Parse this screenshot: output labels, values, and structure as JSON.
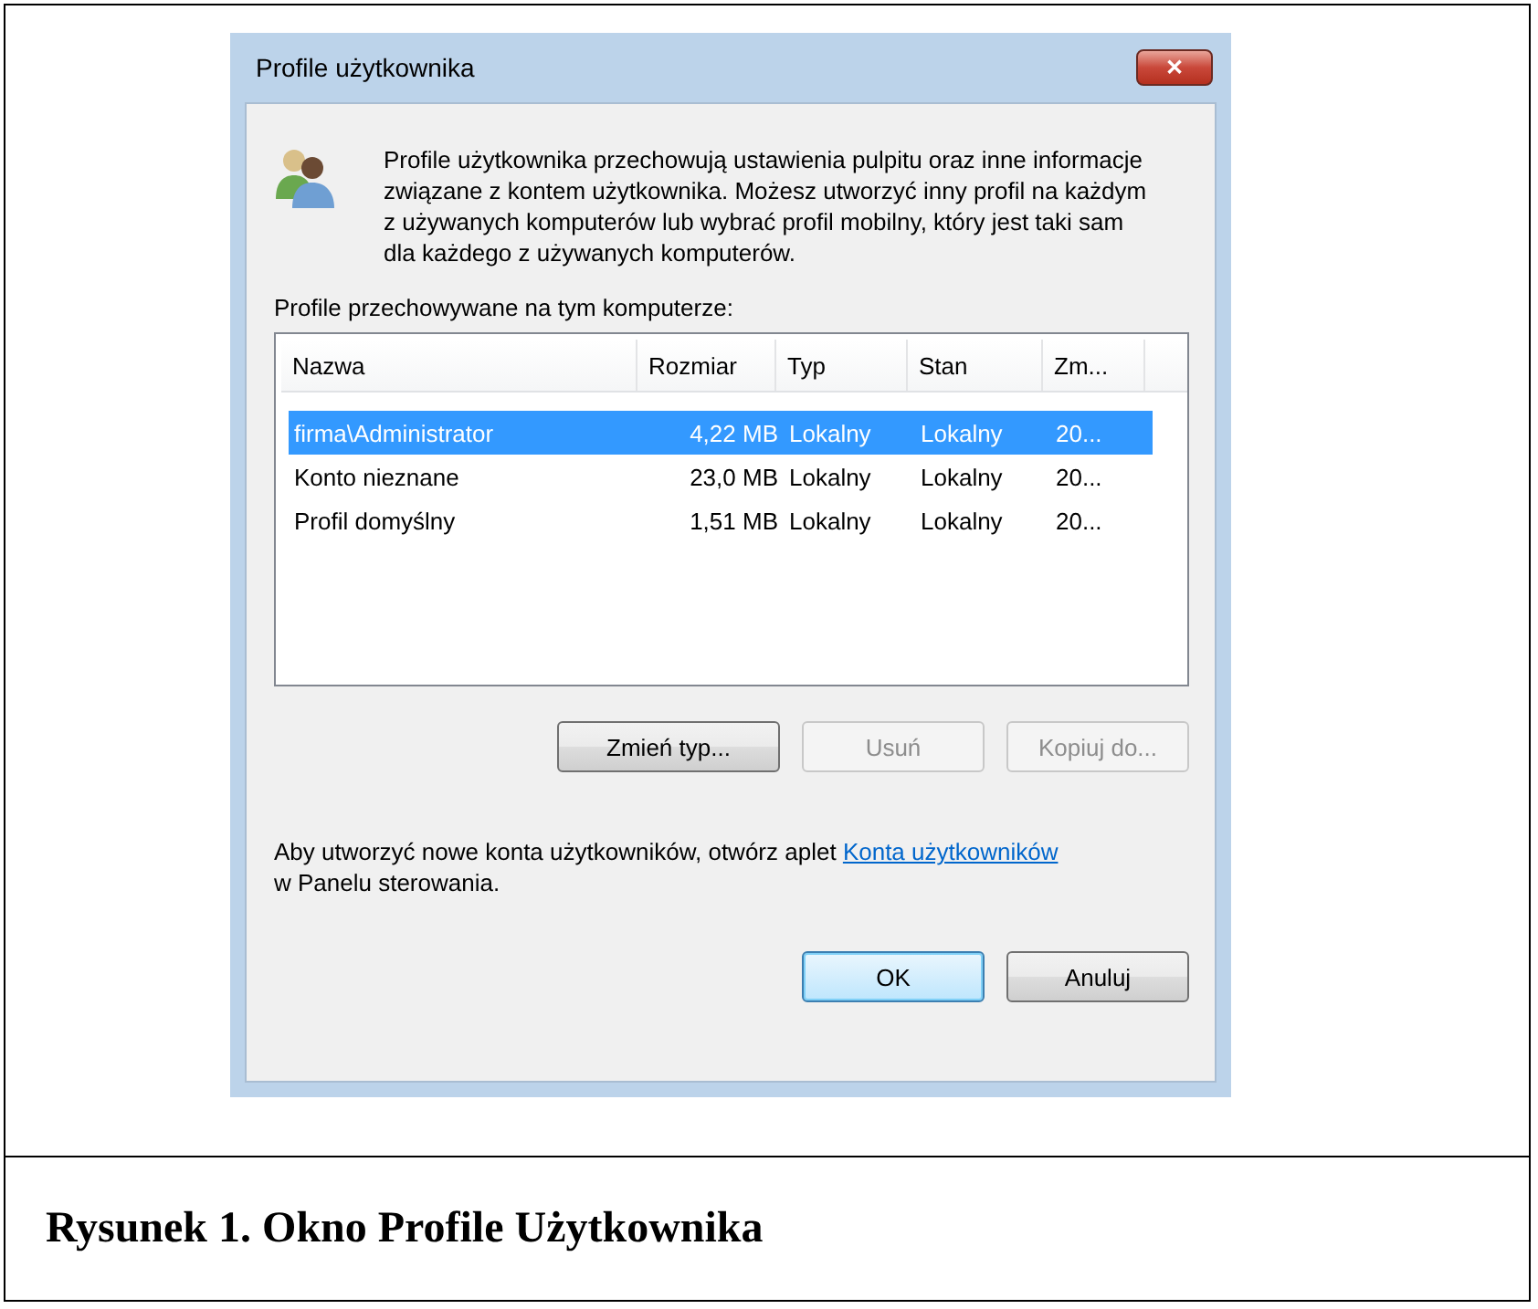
{
  "dialog": {
    "title": "Profile użytkownika",
    "close": "✕",
    "description": "Profile użytkownika przechowują ustawienia pulpitu oraz inne informacje związane z kontem użytkownika. Możesz utworzyć inny profil na każdym z używanych komputerów lub wybrać profil mobilny, który jest taki sam dla każdego z używanych komputerów.",
    "list_label": "Profile przechowywane na tym komputerze:",
    "table": {
      "columns": [
        "Nazwa",
        "Rozmiar",
        "Typ",
        "Stan",
        "Zm..."
      ],
      "rows": [
        {
          "cells": [
            "firma\\Administrator",
            "4,22 MB",
            "Lokalny",
            "Lokalny",
            "20..."
          ],
          "selected": true
        },
        {
          "cells": [
            "Konto nieznane",
            "23,0 MB",
            "Lokalny",
            "Lokalny",
            "20..."
          ],
          "selected": false
        },
        {
          "cells": [
            "Profil domyślny",
            "1,51 MB",
            "Lokalny",
            "Lokalny",
            "20..."
          ],
          "selected": false
        }
      ]
    },
    "actions": [
      {
        "label": "Zmień typ...",
        "disabled": false
      },
      {
        "label": "Usuń",
        "disabled": true
      },
      {
        "label": "Kopiuj do...",
        "disabled": true
      }
    ],
    "footer": [
      {
        "kind": "text",
        "text": "Aby utworzyć nowe konta użytkowników, otwórz aplet "
      },
      {
        "kind": "link",
        "text": "Konta użytkowników"
      },
      {
        "kind": "text",
        "text": " w Panelu sterowania."
      }
    ],
    "buttons": [
      {
        "label": "OK",
        "default": true
      },
      {
        "label": "Anuluj",
        "default": false
      }
    ]
  },
  "caption": "Rysunek 1. Okno Profile Użytkownika"
}
